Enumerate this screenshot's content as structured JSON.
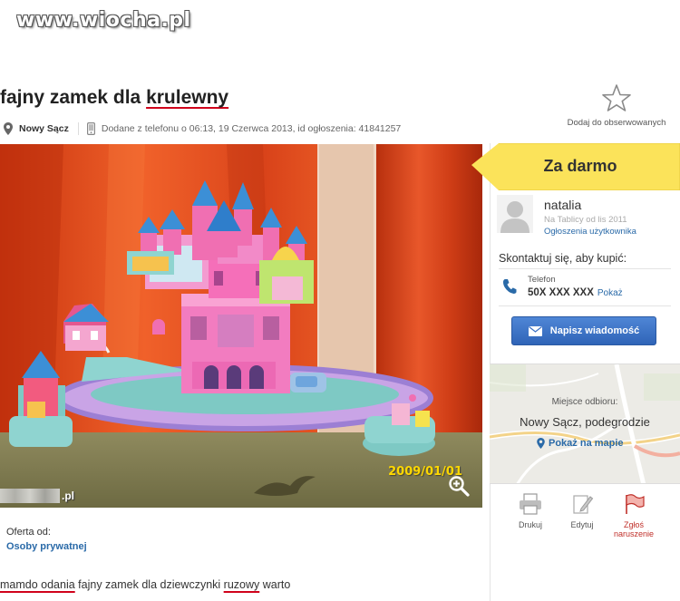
{
  "watermark": "www.wiocha.pl",
  "listing": {
    "title_start": "fajny zamek dla ",
    "title_marked": "krulewny",
    "location": "Nowy Sącz",
    "added": "Dodane z telefonu o 06:13, 19 Czerwca 2013, id ogłoszenia: 41841257",
    "watch_label": "Dodaj do obserwowanych",
    "photo_date": "2009/01/01",
    "photo_watermark": ".pl",
    "offer_label": "Oferta od:",
    "offer_value": "Osoby prywatnej",
    "description": [
      {
        "text": "mamdo odania",
        "marked": true
      },
      {
        "text": " fajny zamek dla dziewczynki ",
        "marked": false
      },
      {
        "text": "ruzowy",
        "marked": true
      },
      {
        "text": " warto",
        "marked": false
      }
    ]
  },
  "sidebar": {
    "price": "Za darmo",
    "user_name": "natalia",
    "user_since": "Na Tablicy od lis 2011",
    "user_ads_link": "Ogłoszenia użytkownika",
    "contact_heading": "Skontaktuj się, aby kupić:",
    "phone_label": "Telefon",
    "phone_number": "50X XXX XXX",
    "phone_show": "Pokaż",
    "message_button": "Napisz wiadomość",
    "map_label": "Miejsce odbioru:",
    "map_city": "Nowy Sącz, podegrodzie",
    "map_link": "Pokaż na mapie",
    "tools": [
      {
        "label": "Drukuj",
        "icon": "printer-icon"
      },
      {
        "label": "Edytuj",
        "icon": "edit-icon"
      },
      {
        "label": "Zgłoś naruszenie",
        "icon": "flag-icon"
      }
    ]
  },
  "colors": {
    "price_bg": "#fbe35a",
    "accent_red": "#d0021b",
    "link_blue": "#2a6aa8",
    "button_blue": "#3b70c4"
  }
}
